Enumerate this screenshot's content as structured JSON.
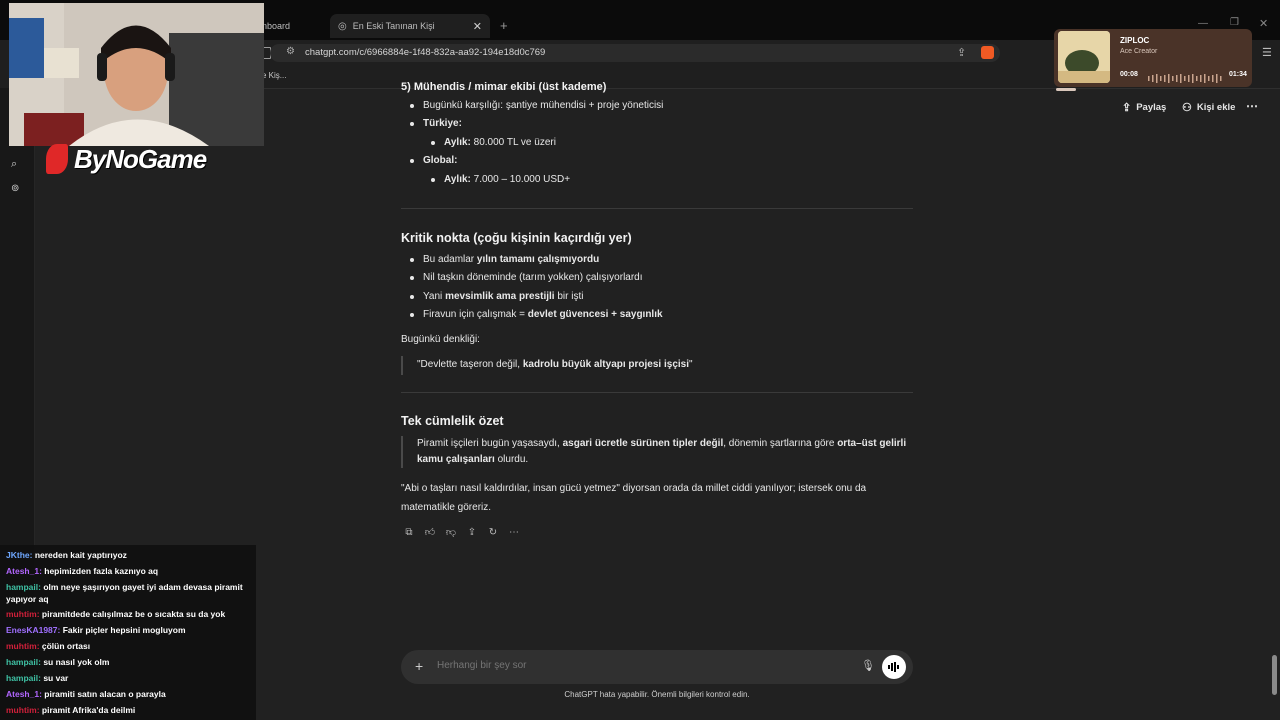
{
  "browser": {
    "tabs": [
      {
        "label": "nboard"
      },
      {
        "label": "En Eski Tanınan Kişi"
      }
    ],
    "url": "chatgpt.com/c/6966884e-1f48-832a-aa92-194e18d0c769",
    "bookmark_label": "e Kiş..."
  },
  "header": {
    "share_label": "Paylaş",
    "add_person_label": "Kişi ekle"
  },
  "content": {
    "section5_heading": "5) Mühendis / mimar ekibi (üst kademe)",
    "s5_items": [
      {
        "text": "Bugünkü karşılığı: şantiye mühendisi + proje yöneticisi"
      },
      {
        "label": "Türkiye:",
        "sub_label": "Aylık:",
        "sub_value": " 80.000 TL ve üzeri"
      },
      {
        "label": "Global:",
        "sub_label": "Aylık:",
        "sub_value": " 7.000 – 10.000 USD+"
      }
    ],
    "critical_heading": "Kritik nokta (çoğu kişinin kaçırdığı yer)",
    "critical_items": [
      {
        "a": "Bu adamlar ",
        "b": "yılın tamamı çalışmıyordu",
        "c": ""
      },
      {
        "a": "Nil taşkın döneminde (tarım yokken) çalışıyorlardı",
        "b": "",
        "c": ""
      },
      {
        "a": "Yani ",
        "b": "mevsimlik ama prestijli",
        "c": " bir işti"
      },
      {
        "a": "Firavun için çalışmak = ",
        "b": "devlet güvencesi + saygınlık",
        "c": ""
      }
    ],
    "equivalent_label": "Bugünkü denkliği:",
    "equivalent_quote": {
      "a": "\"Devlette taşeron değil, ",
      "b": "kadrolu büyük altyapı projesi işçisi",
      "c": "\""
    },
    "summary_heading": "Tek cümlelik özet",
    "summary_quote": {
      "a": "Piramit işçileri bugün yaşasaydı, ",
      "b": "asgari ücretle sürünen tipler değil",
      "c": ", dönemin şartlarına göre ",
      "d": "orta–üst gelirli kamu çalışanları",
      "e": " olurdu."
    },
    "closing": "\"Abi o taşları nasıl kaldırdılar, insan gücü yetmez\" diyorsan orada da millet ciddi yanılıyor; istersek onu da matematikle göreriz."
  },
  "composer": {
    "placeholder": "Herhangi bir şey sor",
    "disclaimer": "ChatGPT hata yapabilir. Önemli bilgileri kontrol edin."
  },
  "overlay": {
    "logo_text": "ByNoGame",
    "player": {
      "title": "ZIPLOC",
      "artist": "Ace Creator",
      "elapsed": "00:08",
      "total": "01:34"
    },
    "chat": [
      {
        "user": "JKthe:",
        "msg": " nereden kait yaptırıyoz",
        "color": "#6fa8ff"
      },
      {
        "user": "Atesh_1:",
        "msg": " hepimizden fazla kaznıyo aq",
        "color": "#b266ff"
      },
      {
        "user": "hampail:",
        "msg": " olm neye şaşırıyon gayet iyi adam devasa piramit yapıyor aq",
        "color": "#3fc2a5"
      },
      {
        "user": "muhtim:",
        "msg": " piramitdede calışılmaz be o sıcakta su da yok",
        "color": "#d0203a"
      },
      {
        "user": "EnesKA1987:",
        "msg": " Fakir piçler hepsini mogluyom",
        "color": "#a070ff"
      },
      {
        "user": "muhtim:",
        "msg": " çölün ortası",
        "color": "#d0203a"
      },
      {
        "user": "hampail:",
        "msg": " su nasıl yok olm",
        "color": "#3fc2a5"
      },
      {
        "user": "hampail:",
        "msg": " su var",
        "color": "#3fc2a5"
      },
      {
        "user": "Atesh_1:",
        "msg": " piramiti satın alacan o parayla",
        "color": "#b266ff"
      },
      {
        "user": "muhtim:",
        "msg": " piramit Afrika'da deilmi",
        "color": "#d0203a"
      }
    ]
  },
  "colors": {
    "page_bg": "#212121",
    "composer_bg": "#303030",
    "player_bg": "#4a3328"
  }
}
